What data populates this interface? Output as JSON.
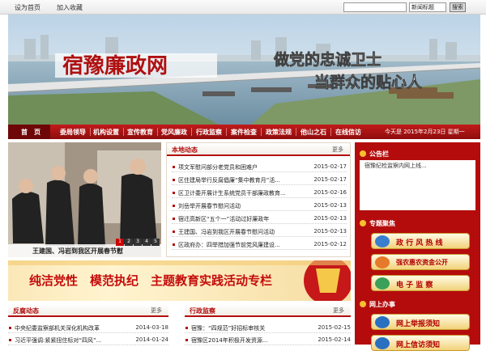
{
  "topbar": {
    "set_home": "设为首页",
    "add_fav": "加入收藏",
    "search_select": "新闻标题",
    "search_button": "搜索"
  },
  "banner": {
    "logo": "宿豫廉政网",
    "slogan1": "做党的忠诚卫士",
    "slogan2": "当群众的贴心人"
  },
  "nav": {
    "items": [
      "首　页",
      "委局领导",
      "机构设置",
      "宣传教育",
      "党风廉政",
      "行政监察",
      "案件检查",
      "政策法规",
      "他山之石",
      "在线信访"
    ],
    "date": "今天是 2015年2月23日 星期一"
  },
  "photo": {
    "caption": "王建国、冯岩到我区开展春节慰",
    "pages": [
      "1",
      "2",
      "3",
      "4",
      "5"
    ]
  },
  "news": {
    "title": "本地动态",
    "more": "更多",
    "items": [
      {
        "t": "项文军慰问部分老党员和困难户",
        "d": "2015-02-17"
      },
      {
        "t": "区住建局举行反腐倡廉“集中教育月”活...",
        "d": "2015-02-17"
      },
      {
        "t": "区卫计委开展计生系统党员干部廉政教育...",
        "d": "2015-02-16"
      },
      {
        "t": "刘岳举开展春节慰问活动",
        "d": "2015-02-13"
      },
      {
        "t": "宿迁高新区“五个一”活动过好廉政年",
        "d": "2015-02-13"
      },
      {
        "t": "王建国、冯岩到我区开展春节慰问活动",
        "d": "2015-02-13"
      },
      {
        "t": "区政府办：四举措加强节前党风廉建设...",
        "d": "2015-02-12"
      }
    ]
  },
  "promo": {
    "text": "纯洁党性　模范执纪　主题教育实践活动专栏"
  },
  "fanfu": {
    "title": "反腐动态",
    "more": "更多",
    "items": [
      {
        "t": "中央纪委监察部机关深化机构改革",
        "d": "2014-03-18"
      },
      {
        "t": "习近平强调:紧紧扭住标对“四风”...",
        "d": "2014-01-24"
      }
    ]
  },
  "xingzheng": {
    "title": "行政监察",
    "more": "更多",
    "items": [
      {
        "t": "宿豫：“四规范”好招标审核关",
        "d": "2015-02-15"
      },
      {
        "t": "宿豫区2014年积极开发资源...",
        "d": "2015-02-14"
      }
    ]
  },
  "sidebar": {
    "notice_title": "公告栏",
    "notice_text": "宿豫纪检监察内网上线...",
    "special_title": "专题聚焦",
    "buttons": [
      "政 行 风 热 线",
      "强农惠农资金公开",
      "电 子 监 察"
    ],
    "online_title": "网上办事",
    "online_buttons": [
      "网上举报须知",
      "网上信访须知"
    ]
  },
  "colors": {
    "nav_red": "#b30f0f",
    "sidebar_red": "#b40c0c"
  }
}
